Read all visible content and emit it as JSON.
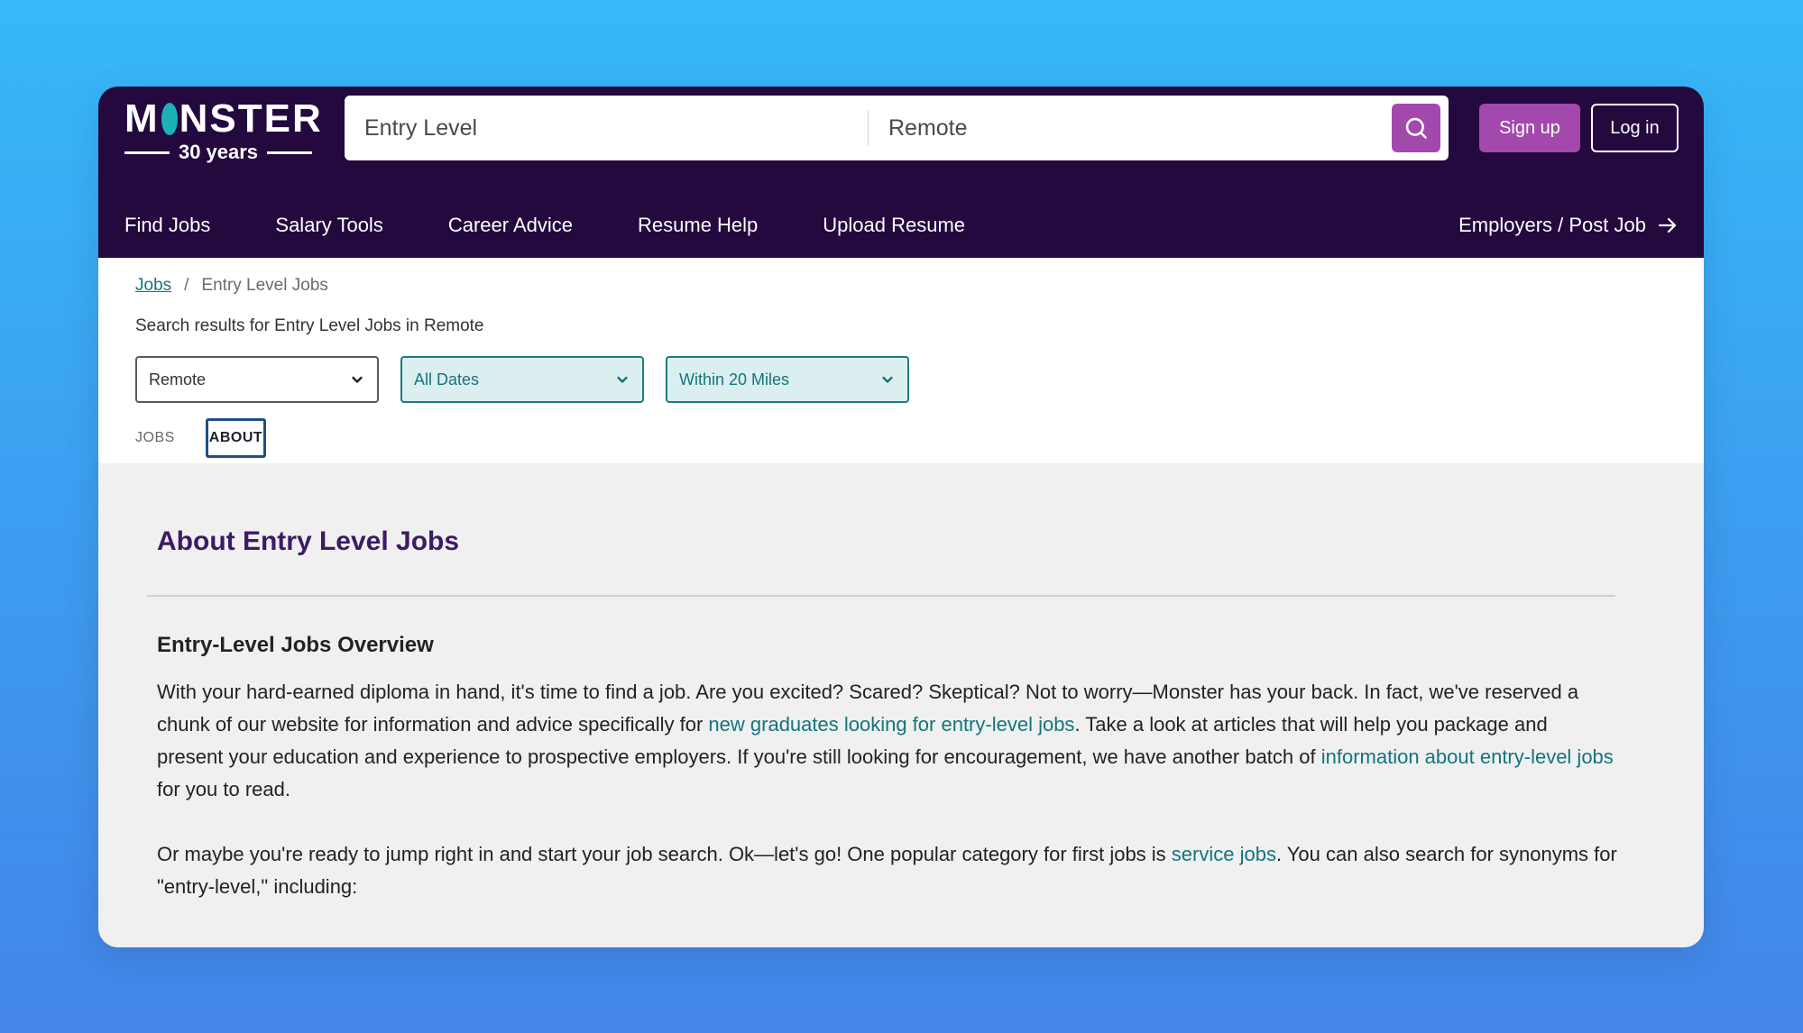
{
  "header": {
    "logo": {
      "word": "MONSTER",
      "subtitle": "30 years"
    },
    "search": {
      "keyword_value": "Entry Level",
      "location_value": "Remote",
      "search_icon": "search-icon"
    },
    "signup_label": "Sign up",
    "login_label": "Log in",
    "nav": [
      "Find Jobs",
      "Salary Tools",
      "Career Advice",
      "Resume Help",
      "Upload Resume"
    ],
    "employers_label": "Employers / Post Job",
    "employers_icon": "arrow-right-icon"
  },
  "breadcrumb": {
    "root": "Jobs",
    "separator": "/",
    "current": "Entry Level Jobs"
  },
  "results_text": "Search results for Entry Level Jobs in Remote",
  "filters": [
    {
      "label": "Remote",
      "active": false
    },
    {
      "label": "All Dates",
      "active": true
    },
    {
      "label": "Within 20 Miles",
      "active": true
    }
  ],
  "tabs": [
    {
      "label": "JOBS",
      "selected": false
    },
    {
      "label": "ABOUT",
      "selected": true
    }
  ],
  "content": {
    "about_title": "About Entry Level Jobs",
    "overview_title": "Entry-Level Jobs Overview",
    "para1": {
      "t1": "With your hard-earned diploma in hand, it's time to find a job. Are you excited? Scared? Skeptical? Not to worry—Monster has your back. In fact, we've reserved a chunk of our website for information and advice specifically for ",
      "link1": "new graduates looking for entry-level jobs",
      "t2": ". Take a look at articles that will help you package and present your education and experience to prospective employers. If you're still looking for encouragement, we have another batch of ",
      "link2": "information about entry-level jobs",
      "t3": " for you to read."
    },
    "para2": {
      "t1": "Or maybe you're ready to jump right in and start your job search. Ok—let's go! One popular category for first jobs is ",
      "link1": "service jobs",
      "t2": ". You can also search for synonyms for \"entry-level,\" including:"
    }
  },
  "colors": {
    "header_bg": "#23093e",
    "accent_purple": "#a348ad",
    "link_teal": "#12757b",
    "logo_o": "#1db0b7"
  }
}
